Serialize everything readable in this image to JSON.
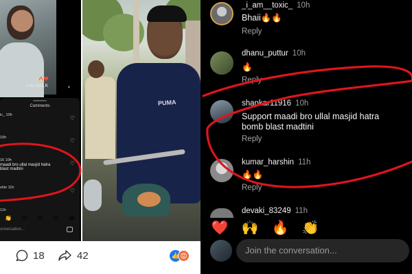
{
  "left_panel": {
    "watermark": "LALKALK",
    "comments_title": "Comments",
    "rows": [
      {
        "user": "ic_ 10h",
        "text": ""
      },
      {
        "user": "10h",
        "text": ""
      },
      {
        "user": "16 10h",
        "text": "maadi bro ullal masjid hatra\nblast madtini"
      },
      {
        "user": "shin 11h",
        "text": ""
      },
      {
        "user": "11h",
        "text": ""
      }
    ],
    "emojis": [
      "👏",
      "😢",
      "😍",
      "😮",
      "😂"
    ],
    "input_placeholder": "onversation..."
  },
  "footer": {
    "comments_count": "18",
    "shares_count": "42"
  },
  "comments": [
    {
      "username": "_i_am__toxic_",
      "time": "10h",
      "text": "Bhaii🔥🔥",
      "reply": "Reply"
    },
    {
      "username": "dhanu_puttur",
      "time": "10h",
      "text": "🔥",
      "reply": "Reply"
    },
    {
      "username": "shankar11916",
      "time": "10h",
      "text": "Support maadi bro ullal masjid hatra bomb blast madtini",
      "reply": "Reply"
    },
    {
      "username": "kumar_harshin",
      "time": "11h",
      "text": "🔥🔥",
      "reply": "Reply"
    },
    {
      "username": "devaki_83249",
      "time": "11h",
      "text": "",
      "reply": ""
    }
  ],
  "emoji_bar": [
    "❤️",
    "🙌",
    "🔥",
    "👏",
    "😢",
    "😍",
    "😮"
  ],
  "input": {
    "placeholder": "Join the conversation..."
  },
  "colors": {
    "annotation": "#e0141c",
    "comment_bg": "#000000",
    "input_bg": "#262626"
  }
}
